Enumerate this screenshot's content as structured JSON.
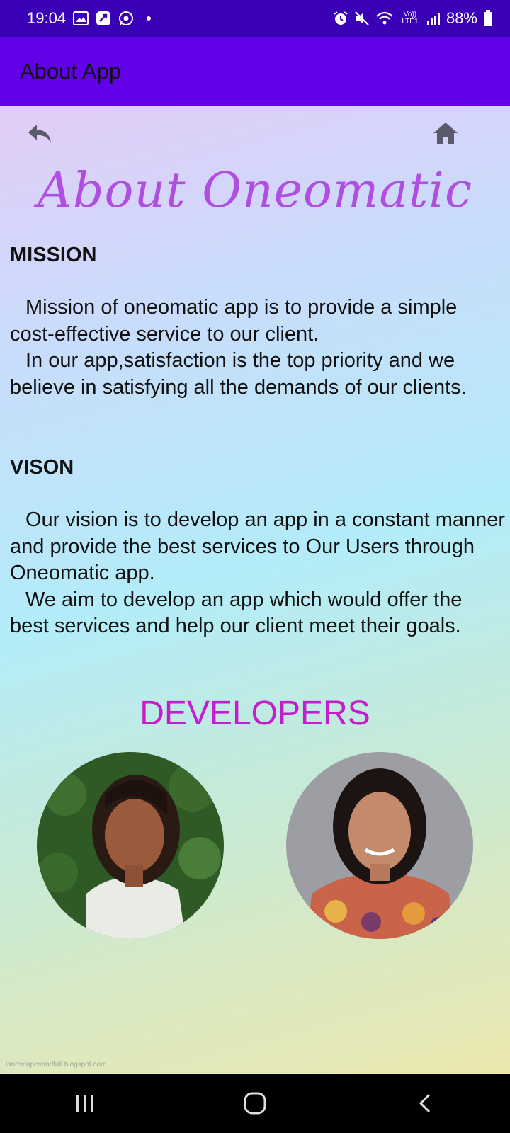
{
  "status_bar": {
    "time": "19:04",
    "battery_percent": "88%",
    "network_label": "Vo)) LTE1"
  },
  "app_bar": {
    "title": "About App"
  },
  "page": {
    "title": "About Oneomatic",
    "mission": {
      "heading": "MISSION",
      "paragraphs": [
        "Mission of oneomatic app is to provide a simple cost-effective service to our client.",
        "In our app,satisfaction is the top priority and we believe in satisfying all the demands of our clients."
      ]
    },
    "vision": {
      "heading": "VISON",
      "paragraphs": [
        "Our vision is to develop an app in a constant manner and provide the best services to Our Users through Oneomatic app.",
        "We aim to develop an app which would offer the best services and help our client meet their goals."
      ]
    },
    "developers_heading": "DEVELOPERS",
    "watermark": "landscapesandfull.blogspot.com"
  },
  "colors": {
    "status_bar": "#3a00b6",
    "app_bar": "#6200ea",
    "title": "#b14ee2",
    "developers_heading": "#c41ccf"
  },
  "icons": [
    "image-icon",
    "app-icon",
    "whatsapp-icon",
    "alarm-icon",
    "mute-icon",
    "wifi-icon",
    "signal-icon",
    "battery-icon",
    "back-arrow-icon",
    "home-icon",
    "recents-icon",
    "home-nav-icon",
    "back-nav-icon"
  ]
}
